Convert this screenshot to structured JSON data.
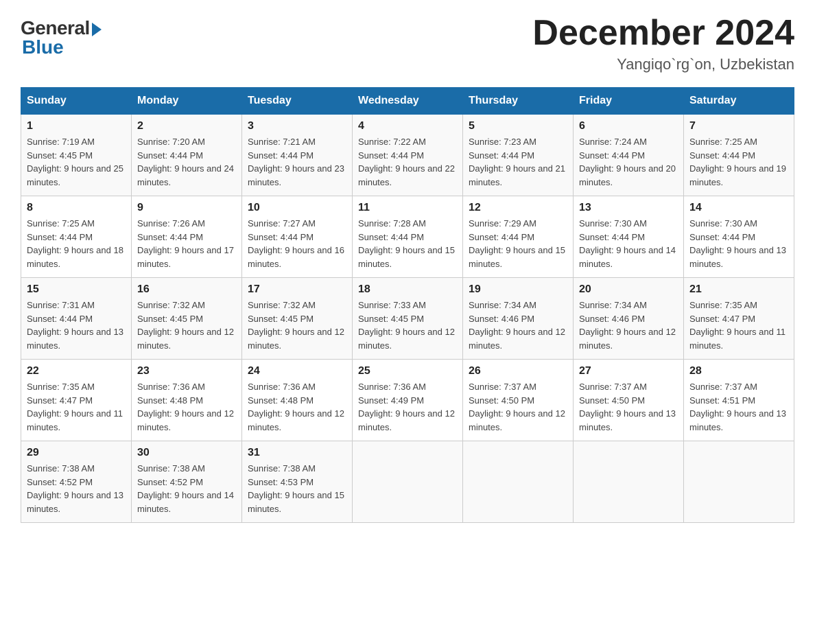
{
  "logo": {
    "general": "General",
    "blue": "Blue"
  },
  "title": {
    "month_year": "December 2024",
    "location": "Yangiqo`rg`on, Uzbekistan"
  },
  "headers": [
    "Sunday",
    "Monday",
    "Tuesday",
    "Wednesday",
    "Thursday",
    "Friday",
    "Saturday"
  ],
  "weeks": [
    [
      {
        "day": "1",
        "sunrise": "7:19 AM",
        "sunset": "4:45 PM",
        "daylight": "9 hours and 25 minutes."
      },
      {
        "day": "2",
        "sunrise": "7:20 AM",
        "sunset": "4:44 PM",
        "daylight": "9 hours and 24 minutes."
      },
      {
        "day": "3",
        "sunrise": "7:21 AM",
        "sunset": "4:44 PM",
        "daylight": "9 hours and 23 minutes."
      },
      {
        "day": "4",
        "sunrise": "7:22 AM",
        "sunset": "4:44 PM",
        "daylight": "9 hours and 22 minutes."
      },
      {
        "day": "5",
        "sunrise": "7:23 AM",
        "sunset": "4:44 PM",
        "daylight": "9 hours and 21 minutes."
      },
      {
        "day": "6",
        "sunrise": "7:24 AM",
        "sunset": "4:44 PM",
        "daylight": "9 hours and 20 minutes."
      },
      {
        "day": "7",
        "sunrise": "7:25 AM",
        "sunset": "4:44 PM",
        "daylight": "9 hours and 19 minutes."
      }
    ],
    [
      {
        "day": "8",
        "sunrise": "7:25 AM",
        "sunset": "4:44 PM",
        "daylight": "9 hours and 18 minutes."
      },
      {
        "day": "9",
        "sunrise": "7:26 AM",
        "sunset": "4:44 PM",
        "daylight": "9 hours and 17 minutes."
      },
      {
        "day": "10",
        "sunrise": "7:27 AM",
        "sunset": "4:44 PM",
        "daylight": "9 hours and 16 minutes."
      },
      {
        "day": "11",
        "sunrise": "7:28 AM",
        "sunset": "4:44 PM",
        "daylight": "9 hours and 15 minutes."
      },
      {
        "day": "12",
        "sunrise": "7:29 AM",
        "sunset": "4:44 PM",
        "daylight": "9 hours and 15 minutes."
      },
      {
        "day": "13",
        "sunrise": "7:30 AM",
        "sunset": "4:44 PM",
        "daylight": "9 hours and 14 minutes."
      },
      {
        "day": "14",
        "sunrise": "7:30 AM",
        "sunset": "4:44 PM",
        "daylight": "9 hours and 13 minutes."
      }
    ],
    [
      {
        "day": "15",
        "sunrise": "7:31 AM",
        "sunset": "4:44 PM",
        "daylight": "9 hours and 13 minutes."
      },
      {
        "day": "16",
        "sunrise": "7:32 AM",
        "sunset": "4:45 PM",
        "daylight": "9 hours and 12 minutes."
      },
      {
        "day": "17",
        "sunrise": "7:32 AM",
        "sunset": "4:45 PM",
        "daylight": "9 hours and 12 minutes."
      },
      {
        "day": "18",
        "sunrise": "7:33 AM",
        "sunset": "4:45 PM",
        "daylight": "9 hours and 12 minutes."
      },
      {
        "day": "19",
        "sunrise": "7:34 AM",
        "sunset": "4:46 PM",
        "daylight": "9 hours and 12 minutes."
      },
      {
        "day": "20",
        "sunrise": "7:34 AM",
        "sunset": "4:46 PM",
        "daylight": "9 hours and 12 minutes."
      },
      {
        "day": "21",
        "sunrise": "7:35 AM",
        "sunset": "4:47 PM",
        "daylight": "9 hours and 11 minutes."
      }
    ],
    [
      {
        "day": "22",
        "sunrise": "7:35 AM",
        "sunset": "4:47 PM",
        "daylight": "9 hours and 11 minutes."
      },
      {
        "day": "23",
        "sunrise": "7:36 AM",
        "sunset": "4:48 PM",
        "daylight": "9 hours and 12 minutes."
      },
      {
        "day": "24",
        "sunrise": "7:36 AM",
        "sunset": "4:48 PM",
        "daylight": "9 hours and 12 minutes."
      },
      {
        "day": "25",
        "sunrise": "7:36 AM",
        "sunset": "4:49 PM",
        "daylight": "9 hours and 12 minutes."
      },
      {
        "day": "26",
        "sunrise": "7:37 AM",
        "sunset": "4:50 PM",
        "daylight": "9 hours and 12 minutes."
      },
      {
        "day": "27",
        "sunrise": "7:37 AM",
        "sunset": "4:50 PM",
        "daylight": "9 hours and 13 minutes."
      },
      {
        "day": "28",
        "sunrise": "7:37 AM",
        "sunset": "4:51 PM",
        "daylight": "9 hours and 13 minutes."
      }
    ],
    [
      {
        "day": "29",
        "sunrise": "7:38 AM",
        "sunset": "4:52 PM",
        "daylight": "9 hours and 13 minutes."
      },
      {
        "day": "30",
        "sunrise": "7:38 AM",
        "sunset": "4:52 PM",
        "daylight": "9 hours and 14 minutes."
      },
      {
        "day": "31",
        "sunrise": "7:38 AM",
        "sunset": "4:53 PM",
        "daylight": "9 hours and 15 minutes."
      },
      null,
      null,
      null,
      null
    ]
  ]
}
